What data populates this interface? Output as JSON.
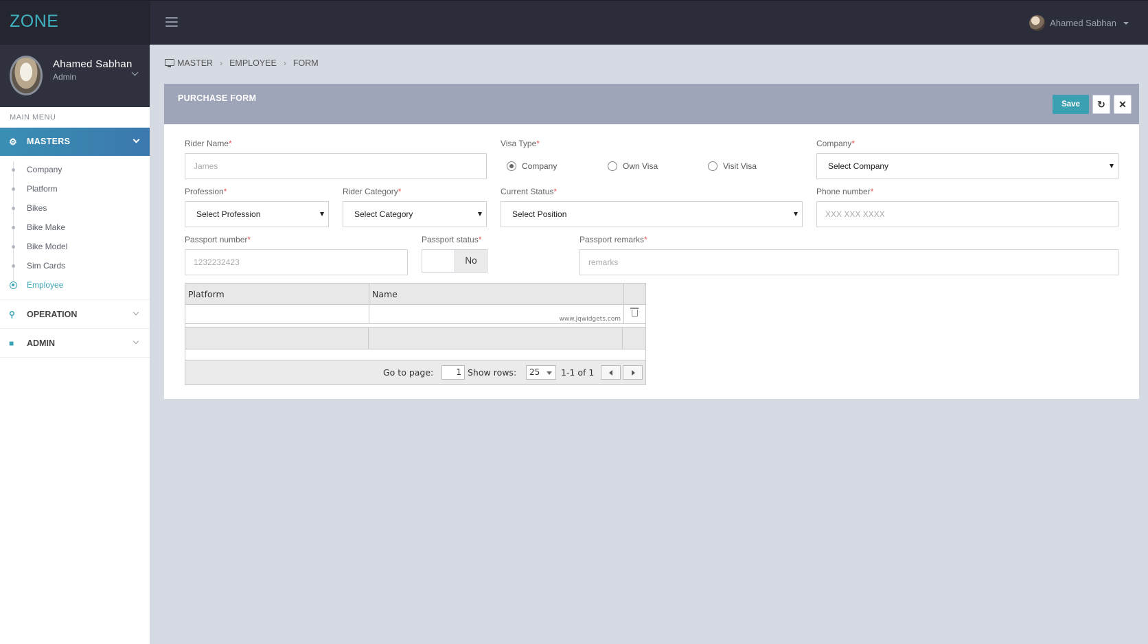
{
  "brand": {
    "name": "ZONE"
  },
  "header": {
    "user_name": "Ahamed Sabhan"
  },
  "sidebar": {
    "profile": {
      "name": "Ahamed Sabhan",
      "role": "Admin"
    },
    "menu_title": "MAIN MENU",
    "masters": {
      "label": "MASTERS",
      "items": [
        {
          "label": "Company"
        },
        {
          "label": "Platform"
        },
        {
          "label": "Bikes"
        },
        {
          "label": "Bike Make"
        },
        {
          "label": "Bike Model"
        },
        {
          "label": "Sim Cards"
        },
        {
          "label": "Employee",
          "active": true
        }
      ]
    },
    "operation": {
      "label": "OPERATION"
    },
    "admin": {
      "label": "ADMIN"
    }
  },
  "breadcrumb": [
    "MASTER",
    "EMPLOYEE",
    "FORM"
  ],
  "panel": {
    "title": "PURCHASE FORM",
    "save_label": "Save"
  },
  "form": {
    "rider_name": {
      "label": "Rider Name",
      "placeholder": "James"
    },
    "visa_type": {
      "label": "Visa Type",
      "options": [
        "Company",
        "Own Visa",
        "Visit Visa"
      ],
      "selected": "Company"
    },
    "company": {
      "label": "Company",
      "value": "Select Company"
    },
    "profession": {
      "label": "Profession",
      "value": "Select Profession"
    },
    "rider_category": {
      "label": "Rider Category",
      "value": "Select Category"
    },
    "current_status": {
      "label": "Current Status",
      "value": "Select Position"
    },
    "phone": {
      "label": "Phone number",
      "placeholder": "XXX XXX XXXX"
    },
    "passport_number": {
      "label": "Passport number",
      "placeholder": "1232232423"
    },
    "passport_status": {
      "label": "Passport status",
      "value": "No"
    },
    "passport_remarks": {
      "label": "Passport remarks",
      "placeholder": "remarks"
    },
    "required_mark": "*"
  },
  "grid": {
    "columns": [
      "Platform",
      "Name"
    ],
    "watermark": "www.jqwidgets.com",
    "pager": {
      "goto_label": "Go to page:",
      "page": "1",
      "rows_label": "Show rows:",
      "rows": "25",
      "range": "1-1 of 1"
    }
  },
  "colors": {
    "accent": "#3ba0b1",
    "topbar": "#2b2e3a",
    "panel_header": "#9fa5b8"
  },
  "icons": {
    "refresh": "refresh-icon",
    "close": "close-icon",
    "masters": "cogs-icon",
    "operation": "motorcycle-icon",
    "admin": "lock-icon"
  }
}
